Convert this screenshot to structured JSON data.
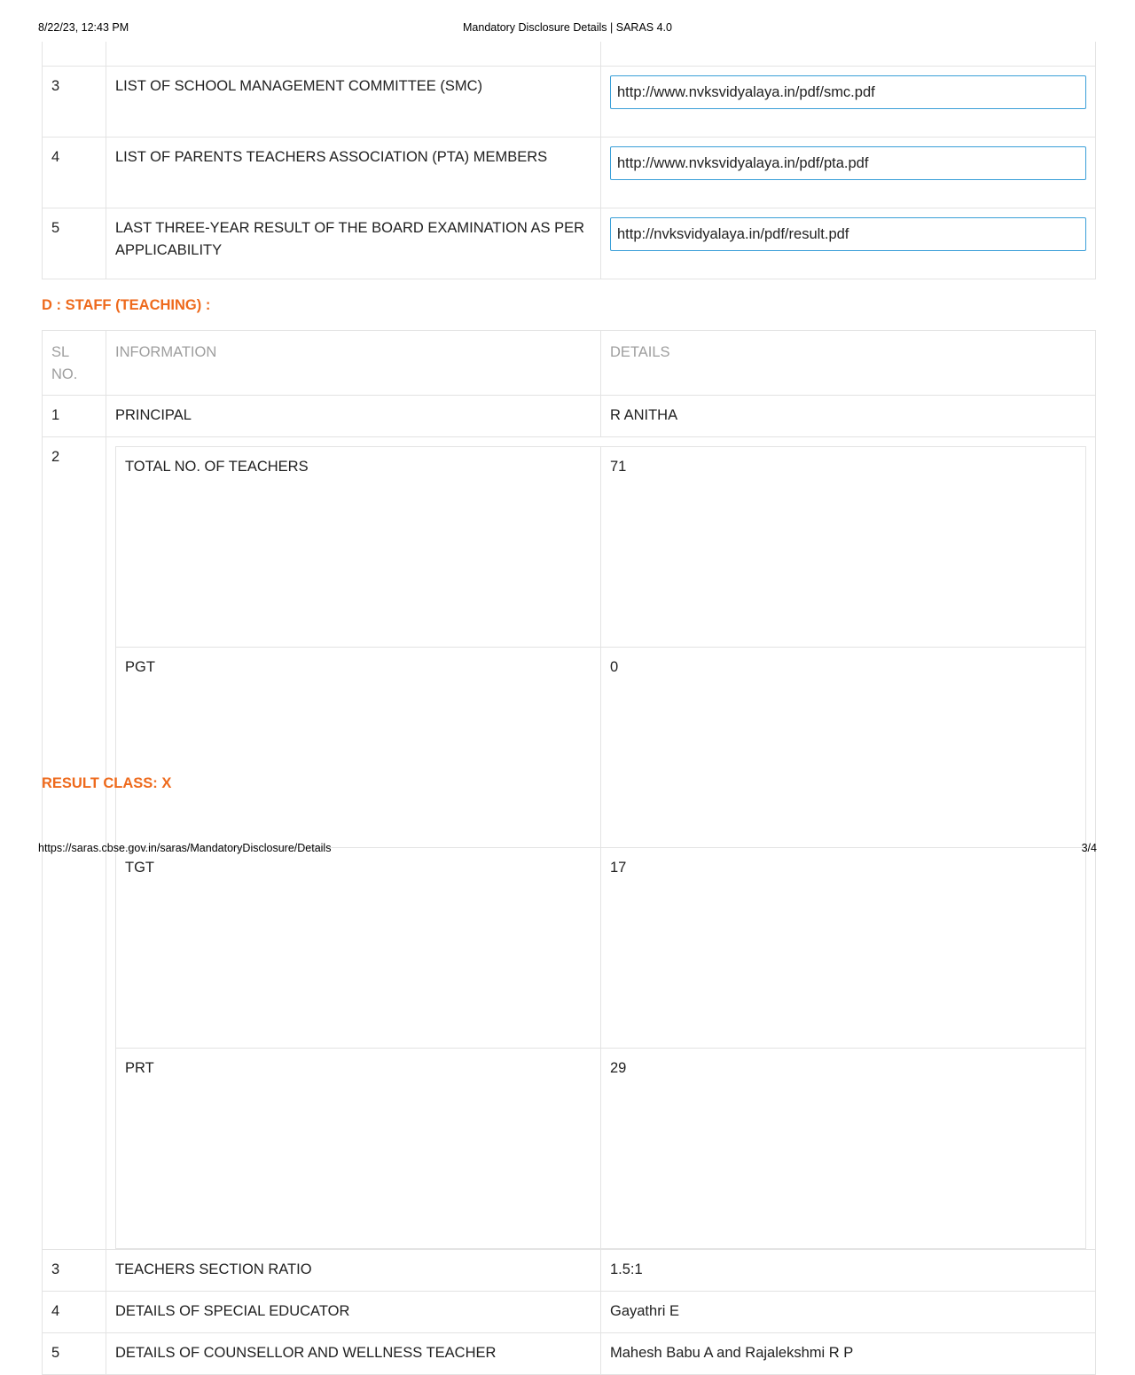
{
  "header": {
    "datetime": "8/22/23, 12:43 PM",
    "title": "Mandatory Disclosure Details | SARAS 4.0"
  },
  "footer": {
    "url": "https://saras.cbse.gov.in/saras/MandatoryDisclosure/Details",
    "page": "3/4"
  },
  "documents_table": {
    "rows": [
      {
        "no": "3",
        "info": "LIST OF SCHOOL MANAGEMENT COMMITTEE (SMC)",
        "link": "http://www.nvksvidyalaya.in/pdf/smc.pdf"
      },
      {
        "no": "4",
        "info": "LIST OF PARENTS TEACHERS ASSOCIATION (PTA) MEMBERS",
        "link": "http://www.nvksvidyalaya.in/pdf/pta.pdf"
      },
      {
        "no": "5",
        "info": "LAST THREE-YEAR RESULT OF THE BOARD EXAMINATION AS PER APPLICABILITY",
        "link": "http://nvksvidyalaya.in/pdf/result.pdf"
      }
    ]
  },
  "staff_section": {
    "title": "D : STAFF (TEACHING) :",
    "headers": {
      "sl": "SL NO.",
      "info": "INFORMATION",
      "details": "DETAILS"
    },
    "row1": {
      "no": "1",
      "info": "PRINCIPAL",
      "details": "R ANITHA"
    },
    "row2": {
      "no": "2",
      "inner": [
        {
          "label": "TOTAL NO. OF TEACHERS",
          "value": "71"
        },
        {
          "label": "PGT",
          "value": "0"
        },
        {
          "label": "TGT",
          "value": "17"
        },
        {
          "label": "PRT",
          "value": "29"
        }
      ]
    },
    "row3": {
      "no": "3",
      "info": "TEACHERS SECTION RATIO",
      "details": "1.5:1"
    },
    "row4": {
      "no": "4",
      "info": "DETAILS OF SPECIAL EDUCATOR",
      "details": "Gayathri E"
    },
    "row5": {
      "no": "5",
      "info": "DETAILS OF COUNSELLOR AND WELLNESS TEACHER",
      "details": "Mahesh Babu A and Rajalekshmi R P"
    }
  },
  "result_section": {
    "title": "RESULT CLASS: X"
  }
}
